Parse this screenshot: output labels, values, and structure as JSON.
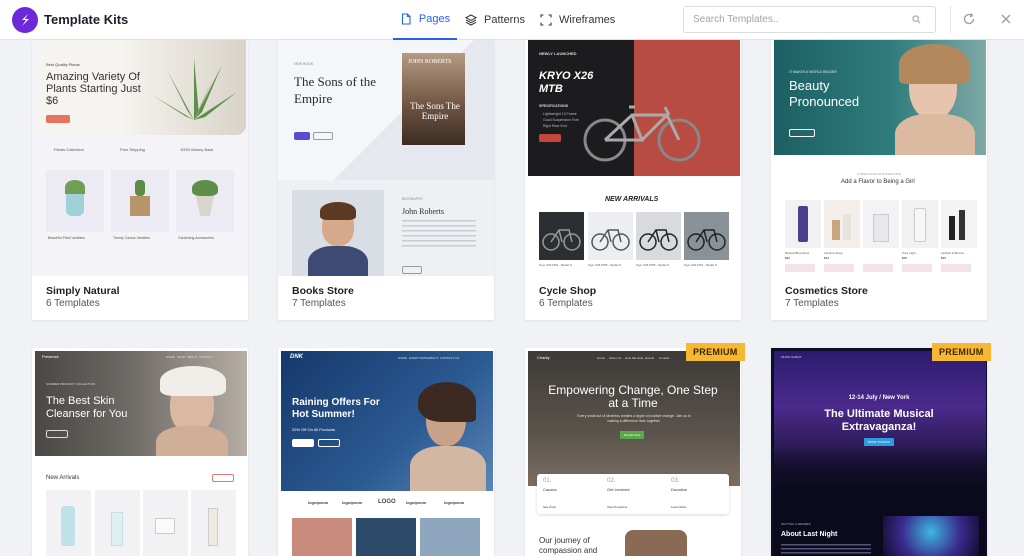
{
  "app": {
    "title": "Template Kits"
  },
  "tabs": [
    {
      "label": "Pages",
      "icon": "document-icon",
      "active": true
    },
    {
      "label": "Patterns",
      "icon": "layers-icon",
      "active": false
    },
    {
      "label": "Wireframes",
      "icon": "wireframe-icon",
      "active": false
    }
  ],
  "search": {
    "placeholder": "Search Templates.."
  },
  "colors": {
    "accent": "#2563eb",
    "brand": "#6d28d9",
    "premium": "#f7b733"
  },
  "kits": [
    {
      "name": "Simply Natural",
      "count": "6 Templates",
      "preview": {
        "eyebrow": "Best Quality Plants",
        "headline": "Amazing Variety Of Plants Starting Just $6",
        "features": [
          "Plants Collection",
          "Free Shipping",
          "100% Money Back"
        ],
        "products": [
          "Beautiful Plant Varieties",
          "Trendy Cactus Varieties",
          "Gardening Accessories"
        ]
      }
    },
    {
      "name": "Books Store",
      "count": "7 Templates",
      "preview": {
        "eyebrow": "NEW BOOK",
        "headline": "The Sons of the Empire",
        "cover_author": "JOHN ROBERTS",
        "cover_title": "The Sons The Empire",
        "author_label": "BIOGRAPHY",
        "author_name": "John Roberts"
      }
    },
    {
      "name": "Cycle Shop",
      "count": "6 Templates",
      "preview": {
        "eyebrow": "NEWLY LAUNCHED",
        "headline": "KRYO X26 MTB",
        "specs_label": "SPECIFICATIONS",
        "specs": [
          "Lightweight 13 Frame",
          "Good Suspension Fork",
          "Rigid Rear End"
        ],
        "section": "NEW ARRIVALS",
        "products": [
          "Kryo X20 FDS - Model S",
          "Kryo X26 MTB - Model S",
          "Kryo X26 MTB - Model S",
          "Kryo X20 FDS - Model S"
        ]
      }
    },
    {
      "name": "Cosmetics Store",
      "count": "7 Templates",
      "preview": {
        "eyebrow": "IT MAKES A WORLD BIGGER",
        "headline": "Beauty Pronounced",
        "section_eyebrow": "A SPECTRUM OF ATTRACTION",
        "section": "Add a Flavor to Being a Girl",
        "products": [
          "Natural Blue Rose",
          "Lacrima Soap",
          "",
          "Pure Light",
          "Lipstick & Bronze"
        ],
        "prices": [
          "$40",
          "$34",
          "",
          "$45",
          "$45"
        ]
      }
    },
    {
      "name": "",
      "count": "",
      "preview": {
        "logo": "Presence",
        "nav": [
          "HOME",
          "SHOP",
          "ABOUT",
          "CONTACT"
        ],
        "eyebrow": "SUMMER PRODUCT COLLECTION",
        "headline": "The Best Skin Cleanser for You",
        "section": "New Arrivals"
      }
    },
    {
      "name": "",
      "count": "",
      "preview": {
        "logo": "DNK",
        "nav": [
          "HOME",
          "EVERYTHING",
          "ABOUT",
          "CONTACT US"
        ],
        "headline": "Raining Offers For Hot Summer!",
        "subline": "25% Off On All Products",
        "brands": [
          "logoipsum",
          "logoipsum",
          "logoipsum",
          "LOGO",
          "logoipsum",
          "logoipsum"
        ]
      }
    },
    {
      "name": "",
      "count": "",
      "badge": "PREMIUM",
      "preview": {
        "logo": "Charity",
        "nav": [
          "Home",
          "About Us",
          "How We Help",
          "Events",
          "Contact"
        ],
        "headline": "Empowering Change, One Step at a Time",
        "body": "Every small act of kindness creates a ripple of positive change. Join us in making a difference lives together.",
        "cta": "Donate Now",
        "steps": [
          {
            "num": "01.",
            "title": "Causes",
            "link": "See Point"
          },
          {
            "num": "02.",
            "title": "Get Involved",
            "link": "View Programs"
          },
          {
            "num": "03.",
            "title": "Donation",
            "link": "Learn More"
          }
        ],
        "section": "Our journey of compassion and"
      }
    },
    {
      "name": "",
      "count": "",
      "badge": "PREMIUM",
      "preview": {
        "logo": "MUSIC EVENT",
        "date": "12-14 July / New York",
        "headline": "The Ultimate Musical Extravaganza!",
        "cta": "BOOK TICKETS",
        "section_eyebrow": "GETTING A MEMBER",
        "section": "About Last Night"
      }
    }
  ]
}
